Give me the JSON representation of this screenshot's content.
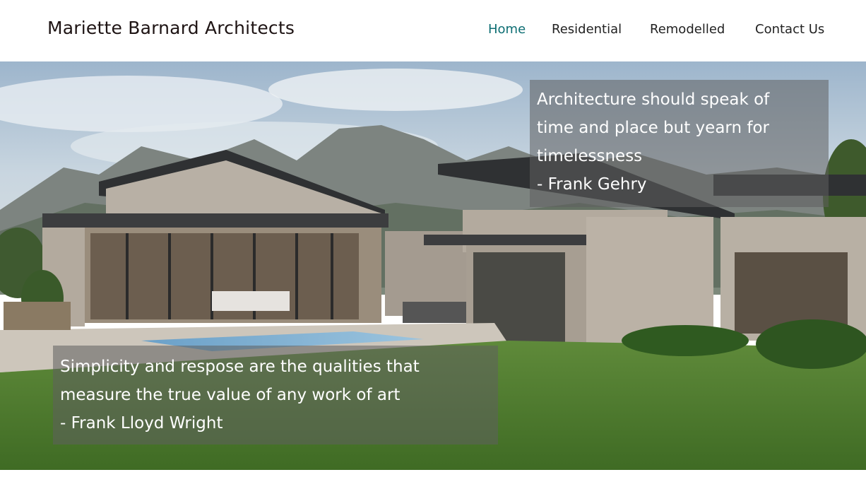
{
  "brand": {
    "name": "Mariette Barnard Architects"
  },
  "nav": {
    "items": [
      {
        "label": "Home",
        "active": true
      },
      {
        "label": "Residential",
        "active": false
      },
      {
        "label": "Remodelled",
        "active": false
      },
      {
        "label": "Contact Us",
        "active": false
      }
    ]
  },
  "hero": {
    "image": "modern-house-photo",
    "quotes": [
      {
        "lines": [
          "Architecture should speak of",
          "time and place but yearn for",
          "timelessness"
        ],
        "author": "- Frank Gehry"
      },
      {
        "lines": [
          "Simplicity and respose are the qualities that",
          "measure the true value of any work of art"
        ],
        "author": "- Frank Lloyd Wright"
      }
    ]
  },
  "colors": {
    "nav_active": "#0d6e73",
    "brand_text": "#1e1414",
    "quote_box": "rgba(95,95,95,0.55)"
  }
}
